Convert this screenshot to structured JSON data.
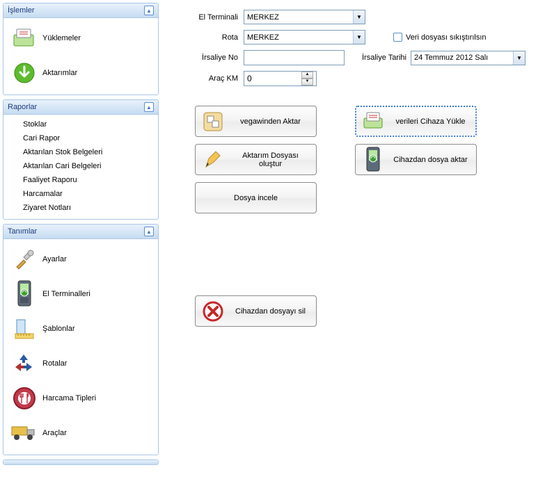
{
  "sidebar": {
    "islemler": {
      "title": "İşlemler",
      "items": [
        {
          "label": "Yüklemeler",
          "name": "nav-yuklemeler"
        },
        {
          "label": "Aktarımlar",
          "name": "nav-aktarimlar"
        }
      ]
    },
    "raporlar": {
      "title": "Raporlar",
      "items": [
        {
          "label": "Stoklar"
        },
        {
          "label": "Cari Rapor"
        },
        {
          "label": "Aktarılan Stok Belgeleri"
        },
        {
          "label": "Aktarılan Cari Belgeleri"
        },
        {
          "label": "Faaliyet Raporu"
        },
        {
          "label": "Harcamalar"
        },
        {
          "label": "Ziyaret Notları"
        }
      ]
    },
    "tanimlar": {
      "title": "Tanımlar",
      "items": [
        {
          "label": "Ayarlar",
          "name": "nav-ayarlar"
        },
        {
          "label": "El Terminalleri",
          "name": "nav-elterminalleri"
        },
        {
          "label": "Şablonlar",
          "name": "nav-sablonlar"
        },
        {
          "label": "Rotalar",
          "name": "nav-rotalar"
        },
        {
          "label": "Harcama Tipleri",
          "name": "nav-harcamatipleri"
        },
        {
          "label": "Araçlar",
          "name": "nav-araclar"
        }
      ]
    }
  },
  "form": {
    "el_terminali_label": "El Terminali",
    "el_terminali_value": "MERKEZ",
    "rota_label": "Rota",
    "rota_value": "MERKEZ",
    "irsaliye_no_label": "İrsaliye No",
    "irsaliye_no_value": "",
    "arac_km_label": "Araç KM",
    "arac_km_value": "0",
    "compress_label": "Veri dosyası sıkıştırılsın",
    "irsaliye_tarihi_label": "İrsaliye Tarihi",
    "irsaliye_tarihi_value": "24 Temmuz 2012    Salı"
  },
  "buttons": {
    "vegawin": "vegawinden Aktar",
    "verileri_cihaza": "verileri Cihaza Yükle",
    "aktarim_olustur": "Aktarım Dosyası oluştur",
    "cihazdan_aktar": "Cihazdan dosya aktar",
    "dosya_incele": "Dosya incele",
    "cihazdan_sil": "Cihazdan dosyayı sil"
  },
  "colors": {
    "header_grad_top": "#e8f1fb",
    "header_grad_bottom": "#c6dcf2",
    "border": "#a9c7e8"
  }
}
